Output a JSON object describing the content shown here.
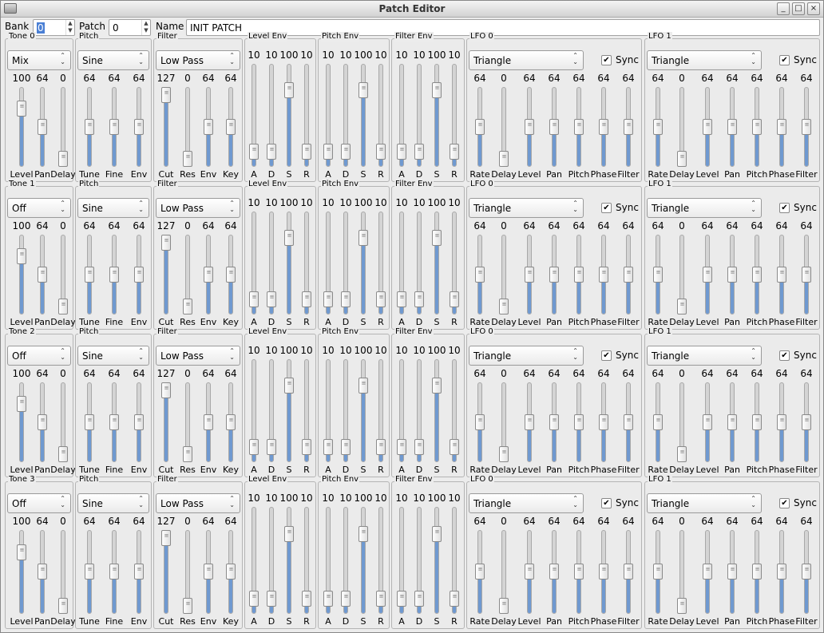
{
  "window": {
    "title": "Patch Editor"
  },
  "header": {
    "bank_label": "Bank",
    "bank_value": "0",
    "patch_label": "Patch",
    "patch_value": "0",
    "name_label": "Name",
    "name_value": "INIT PATCH"
  },
  "window_buttons": {
    "minimize": "_",
    "maximize": "□",
    "close": "×"
  },
  "sync_label": "Sync",
  "tones": [
    {
      "title": "Tone 0",
      "mode": "Mix",
      "tone": {
        "values": [
          100,
          64,
          0
        ],
        "labels": [
          "Level",
          "Pan",
          "Delay"
        ]
      },
      "pitch": {
        "title": "Pitch",
        "wave": "Sine",
        "values": [
          64,
          64,
          64
        ],
        "labels": [
          "Tune",
          "Fine",
          "Env"
        ]
      },
      "filter": {
        "title": "Filter",
        "type": "Low Pass",
        "values": [
          127,
          0,
          64,
          64
        ],
        "labels": [
          "Cut",
          "Res",
          "Env",
          "Key"
        ]
      },
      "level_env": {
        "title": "Level Env",
        "values": [
          10,
          10,
          100,
          10
        ],
        "labels": [
          "A",
          "D",
          "S",
          "R"
        ]
      },
      "pitch_env": {
        "title": "Pitch Env",
        "values": [
          10,
          10,
          100,
          10
        ],
        "labels": [
          "A",
          "D",
          "S",
          "R"
        ]
      },
      "filter_env": {
        "title": "Filter Env",
        "values": [
          10,
          10,
          100,
          10
        ],
        "labels": [
          "A",
          "D",
          "S",
          "R"
        ]
      },
      "lfos": [
        {
          "title": "LFO 0",
          "wave": "Triangle",
          "sync": true,
          "values": [
            64,
            0,
            64,
            64,
            64,
            64,
            64
          ],
          "labels": [
            "Rate",
            "Delay",
            "Level",
            "Pan",
            "Pitch",
            "Phase",
            "Filter"
          ]
        },
        {
          "title": "LFO 1",
          "wave": "Triangle",
          "sync": true,
          "values": [
            64,
            0,
            64,
            64,
            64,
            64,
            64
          ],
          "labels": [
            "Rate",
            "Delay",
            "Level",
            "Pan",
            "Pitch",
            "Phase",
            "Filter"
          ]
        }
      ]
    },
    {
      "title": "Tone 1",
      "mode": "Off",
      "tone": {
        "values": [
          100,
          64,
          0
        ],
        "labels": [
          "Level",
          "Pan",
          "Delay"
        ]
      },
      "pitch": {
        "title": "Pitch",
        "wave": "Sine",
        "values": [
          64,
          64,
          64
        ],
        "labels": [
          "Tune",
          "Fine",
          "Env"
        ]
      },
      "filter": {
        "title": "Filter",
        "type": "Low Pass",
        "values": [
          127,
          0,
          64,
          64
        ],
        "labels": [
          "Cut",
          "Res",
          "Env",
          "Key"
        ]
      },
      "level_env": {
        "title": "Level Env",
        "values": [
          10,
          10,
          100,
          10
        ],
        "labels": [
          "A",
          "D",
          "S",
          "R"
        ]
      },
      "pitch_env": {
        "title": "Pitch Env",
        "values": [
          10,
          10,
          100,
          10
        ],
        "labels": [
          "A",
          "D",
          "S",
          "R"
        ]
      },
      "filter_env": {
        "title": "Filter Env",
        "values": [
          10,
          10,
          100,
          10
        ],
        "labels": [
          "A",
          "D",
          "S",
          "R"
        ]
      },
      "lfos": [
        {
          "title": "LFO 0",
          "wave": "Triangle",
          "sync": true,
          "values": [
            64,
            0,
            64,
            64,
            64,
            64,
            64
          ],
          "labels": [
            "Rate",
            "Delay",
            "Level",
            "Pan",
            "Pitch",
            "Phase",
            "Filter"
          ]
        },
        {
          "title": "LFO 1",
          "wave": "Triangle",
          "sync": true,
          "values": [
            64,
            0,
            64,
            64,
            64,
            64,
            64
          ],
          "labels": [
            "Rate",
            "Delay",
            "Level",
            "Pan",
            "Pitch",
            "Phase",
            "Filter"
          ]
        }
      ]
    },
    {
      "title": "Tone 2",
      "mode": "Off",
      "tone": {
        "values": [
          100,
          64,
          0
        ],
        "labels": [
          "Level",
          "Pan",
          "Delay"
        ]
      },
      "pitch": {
        "title": "Pitch",
        "wave": "Sine",
        "values": [
          64,
          64,
          64
        ],
        "labels": [
          "Tune",
          "Fine",
          "Env"
        ]
      },
      "filter": {
        "title": "Filter",
        "type": "Low Pass",
        "values": [
          127,
          0,
          64,
          64
        ],
        "labels": [
          "Cut",
          "Res",
          "Env",
          "Key"
        ]
      },
      "level_env": {
        "title": "Level Env",
        "values": [
          10,
          10,
          100,
          10
        ],
        "labels": [
          "A",
          "D",
          "S",
          "R"
        ]
      },
      "pitch_env": {
        "title": "Pitch Env",
        "values": [
          10,
          10,
          100,
          10
        ],
        "labels": [
          "A",
          "D",
          "S",
          "R"
        ]
      },
      "filter_env": {
        "title": "Filter Env",
        "values": [
          10,
          10,
          100,
          10
        ],
        "labels": [
          "A",
          "D",
          "S",
          "R"
        ]
      },
      "lfos": [
        {
          "title": "LFO 0",
          "wave": "Triangle",
          "sync": true,
          "values": [
            64,
            0,
            64,
            64,
            64,
            64,
            64
          ],
          "labels": [
            "Rate",
            "Delay",
            "Level",
            "Pan",
            "Pitch",
            "Phase",
            "Filter"
          ]
        },
        {
          "title": "LFO 1",
          "wave": "Triangle",
          "sync": true,
          "values": [
            64,
            0,
            64,
            64,
            64,
            64,
            64
          ],
          "labels": [
            "Rate",
            "Delay",
            "Level",
            "Pan",
            "Pitch",
            "Phase",
            "Filter"
          ]
        }
      ]
    },
    {
      "title": "Tone 3",
      "mode": "Off",
      "tone": {
        "values": [
          100,
          64,
          0
        ],
        "labels": [
          "Level",
          "Pan",
          "Delay"
        ]
      },
      "pitch": {
        "title": "Pitch",
        "wave": "Sine",
        "values": [
          64,
          64,
          64
        ],
        "labels": [
          "Tune",
          "Fine",
          "Env"
        ]
      },
      "filter": {
        "title": "Filter",
        "type": "Low Pass",
        "values": [
          127,
          0,
          64,
          64
        ],
        "labels": [
          "Cut",
          "Res",
          "Env",
          "Key"
        ]
      },
      "level_env": {
        "title": "Level Env",
        "values": [
          10,
          10,
          100,
          10
        ],
        "labels": [
          "A",
          "D",
          "S",
          "R"
        ]
      },
      "pitch_env": {
        "title": "Pitch Env",
        "values": [
          10,
          10,
          100,
          10
        ],
        "labels": [
          "A",
          "D",
          "S",
          "R"
        ]
      },
      "filter_env": {
        "title": "Filter Env",
        "values": [
          10,
          10,
          100,
          10
        ],
        "labels": [
          "A",
          "D",
          "S",
          "R"
        ]
      },
      "lfos": [
        {
          "title": "LFO 0",
          "wave": "Triangle",
          "sync": true,
          "values": [
            64,
            0,
            64,
            64,
            64,
            64,
            64
          ],
          "labels": [
            "Rate",
            "Delay",
            "Level",
            "Pan",
            "Pitch",
            "Phase",
            "Filter"
          ]
        },
        {
          "title": "LFO 1",
          "wave": "Triangle",
          "sync": true,
          "values": [
            64,
            0,
            64,
            64,
            64,
            64,
            64
          ],
          "labels": [
            "Rate",
            "Delay",
            "Level",
            "Pan",
            "Pitch",
            "Phase",
            "Filter"
          ]
        }
      ]
    }
  ],
  "colors": {
    "slider_fill": "#6f99d0",
    "selection": "#4a7fd4"
  }
}
